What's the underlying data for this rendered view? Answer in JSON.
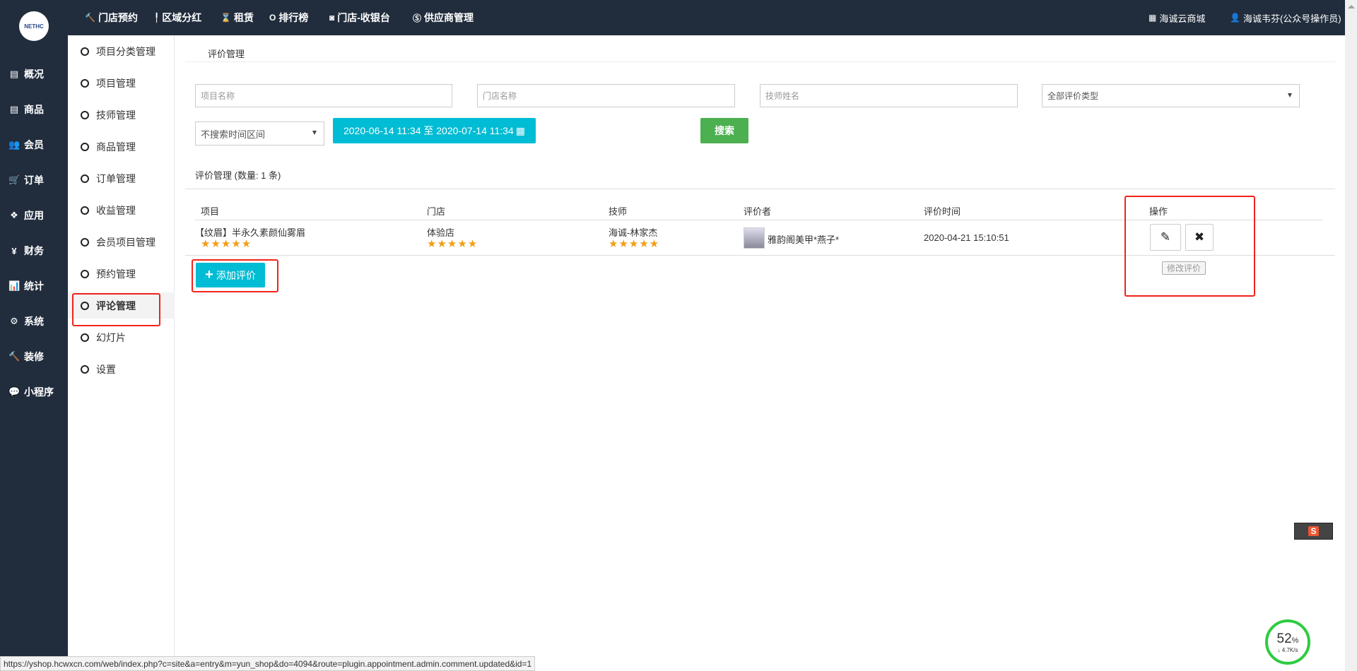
{
  "header": {
    "logo_text": "NETHC",
    "nav": [
      {
        "icon": "hammer-icon",
        "label": "门店预约"
      },
      {
        "icon": "pin-icon",
        "label": "区域分红"
      },
      {
        "icon": "hourglass-icon",
        "label": "租赁"
      },
      {
        "icon": "circle-icon",
        "label": "排行榜"
      },
      {
        "icon": "cashier-icon",
        "label": "门店-收银台"
      },
      {
        "icon": "skype-icon",
        "label": "供应商管理"
      }
    ],
    "shop_link": "海诚云商城",
    "user": "海诚韦芬(公众号操作员)"
  },
  "leftnav": [
    {
      "icon": "box-icon",
      "label": "概况"
    },
    {
      "icon": "box-icon",
      "label": "商品"
    },
    {
      "icon": "users-icon",
      "label": "会员"
    },
    {
      "icon": "cart-icon",
      "label": "订单"
    },
    {
      "icon": "cubes-icon",
      "label": "应用"
    },
    {
      "icon": "yen-icon",
      "label": "财务"
    },
    {
      "icon": "chart-icon",
      "label": "统计"
    },
    {
      "icon": "gears-icon",
      "label": "系统"
    },
    {
      "icon": "gavel-icon",
      "label": "装修"
    },
    {
      "icon": "wechat-icon",
      "label": "小程序"
    }
  ],
  "subnav": {
    "items": [
      "项目分类管理",
      "项目管理",
      "技师管理",
      "商品管理",
      "订单管理",
      "收益管理",
      "会员项目管理",
      "预约管理",
      "评论管理",
      "幻灯片",
      "设置"
    ],
    "active": "评论管理"
  },
  "breadcrumb": "评价管理",
  "filters": {
    "project_placeholder": "项目名称",
    "store_placeholder": "门店名称",
    "tech_placeholder": "技师姓名",
    "type_select": "全部评价类型",
    "time_select": "不搜索时间区间",
    "date_range": "2020-06-14 11:34 至 2020-07-14 11:34",
    "search_label": "搜索"
  },
  "list_title": "评价管理 (数量: 1 条)",
  "table": {
    "headers": [
      "项目",
      "门店",
      "技师",
      "评价者",
      "评价时间",
      "操作"
    ],
    "rows": [
      {
        "project": "【纹眉】半永久素颜仙雾眉",
        "project_stars": 5,
        "store": "体验店",
        "store_stars": 5,
        "tech": "海诚-林家杰",
        "tech_stars": 5,
        "reviewer": "雅韵阁美甲*燕子*",
        "time": "2020-04-21 15:10:51"
      }
    ]
  },
  "edit_tooltip": "修改评价",
  "add_label": "添加评价",
  "status_url": "https://yshop.hcwxcn.com/web/index.php?c=site&a=entry&m=yun_shop&do=4094&route=plugin.appointment.admin.comment.updated&id=1",
  "speed": {
    "percent": "52",
    "unit": "%",
    "rate": "4.7K/s"
  },
  "colors": {
    "topbar": "#212d3d",
    "info": "#00bcd4",
    "success": "#4caf50",
    "highlight": "#f2231b",
    "star": "#f39c12"
  }
}
